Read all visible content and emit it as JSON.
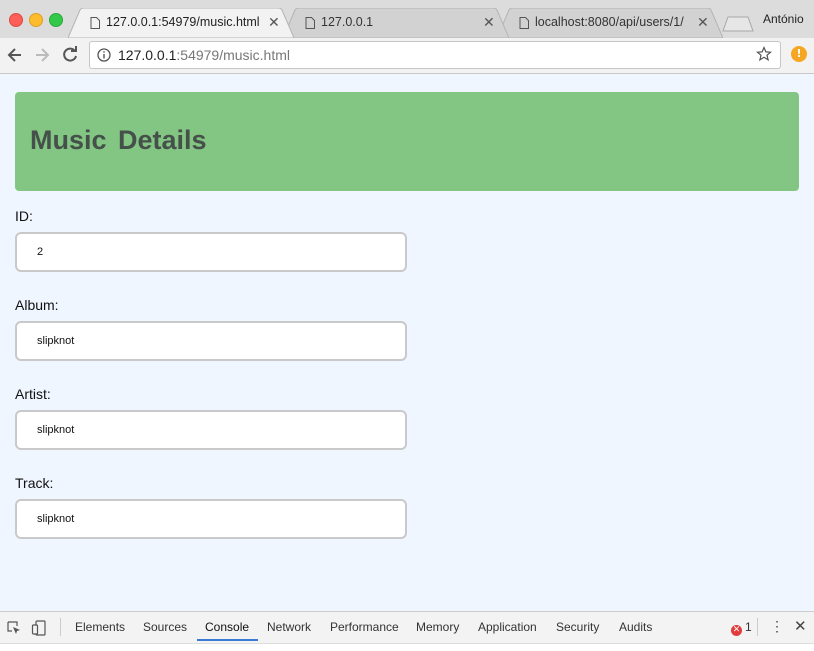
{
  "browser": {
    "tabs": [
      {
        "title": "127.0.0.1:54979/music.html",
        "active": true
      },
      {
        "title": "127.0.0.1",
        "active": false
      },
      {
        "title": "localhost:8080/api/users/1/",
        "active": false
      }
    ],
    "profile_name": "António",
    "url": {
      "host": "127.0.0.1",
      "rest": ":54979/music.html"
    }
  },
  "page": {
    "heading": "Music Details",
    "fields": [
      {
        "label": "ID:",
        "value": "2"
      },
      {
        "label": "Album:",
        "value": "slipknot"
      },
      {
        "label": "Artist:",
        "value": "slipknot"
      },
      {
        "label": "Track:",
        "value": "slipknot"
      }
    ]
  },
  "devtools": {
    "tabs": [
      "Elements",
      "Sources",
      "Console",
      "Network",
      "Performance",
      "Memory",
      "Application",
      "Security",
      "Audits"
    ],
    "active_tab": "Console",
    "error_count": "1"
  },
  "colors": {
    "banner": "#83c683",
    "page_bg": "#f0f6ff",
    "accent": "#3a7bd5"
  }
}
